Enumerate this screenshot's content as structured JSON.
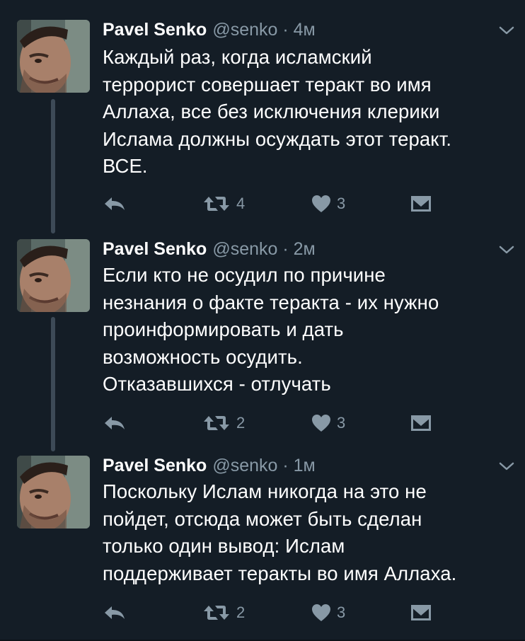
{
  "tweets": [
    {
      "author": {
        "name": "Pavel Senko",
        "handle": "@senko"
      },
      "separator": "·",
      "time": "4м",
      "text_lines": [
        "Каждый раз, когда исламский",
        "террорист совершает теракт во имя",
        "Аллаха, все без исключения клерики",
        "Ислама должны осуждать этот теракт.",
        "ВСЕ."
      ],
      "retweets": "4",
      "likes": "3"
    },
    {
      "author": {
        "name": "Pavel Senko",
        "handle": "@senko"
      },
      "separator": "·",
      "time": "2м",
      "text_lines": [
        "Если кто не осудил по причине",
        "незнания о факте теракта - их нужно",
        "проинформировать и дать",
        "возможность осудить.",
        "Отказавшихся - отлучать"
      ],
      "retweets": "2",
      "likes": "3"
    },
    {
      "author": {
        "name": "Pavel Senko",
        "handle": "@senko"
      },
      "separator": "·",
      "time": "1м",
      "text_lines": [
        "Поскольку Ислам никогда на это не",
        "пойдет, отсюда может быть сделан",
        "только один вывод: Ислам",
        "поддерживает теракты во имя Аллаха."
      ],
      "retweets": "2",
      "likes": "3"
    }
  ],
  "icons": [
    "avatar",
    "chevron-down-icon",
    "reply-icon",
    "retweet-icon",
    "heart-icon",
    "direct-message-icon"
  ],
  "colors": {
    "background": "#141d26",
    "secondary_text": "#8899a6",
    "icon": "#8899a6",
    "thread_line": "#3d4a57"
  }
}
